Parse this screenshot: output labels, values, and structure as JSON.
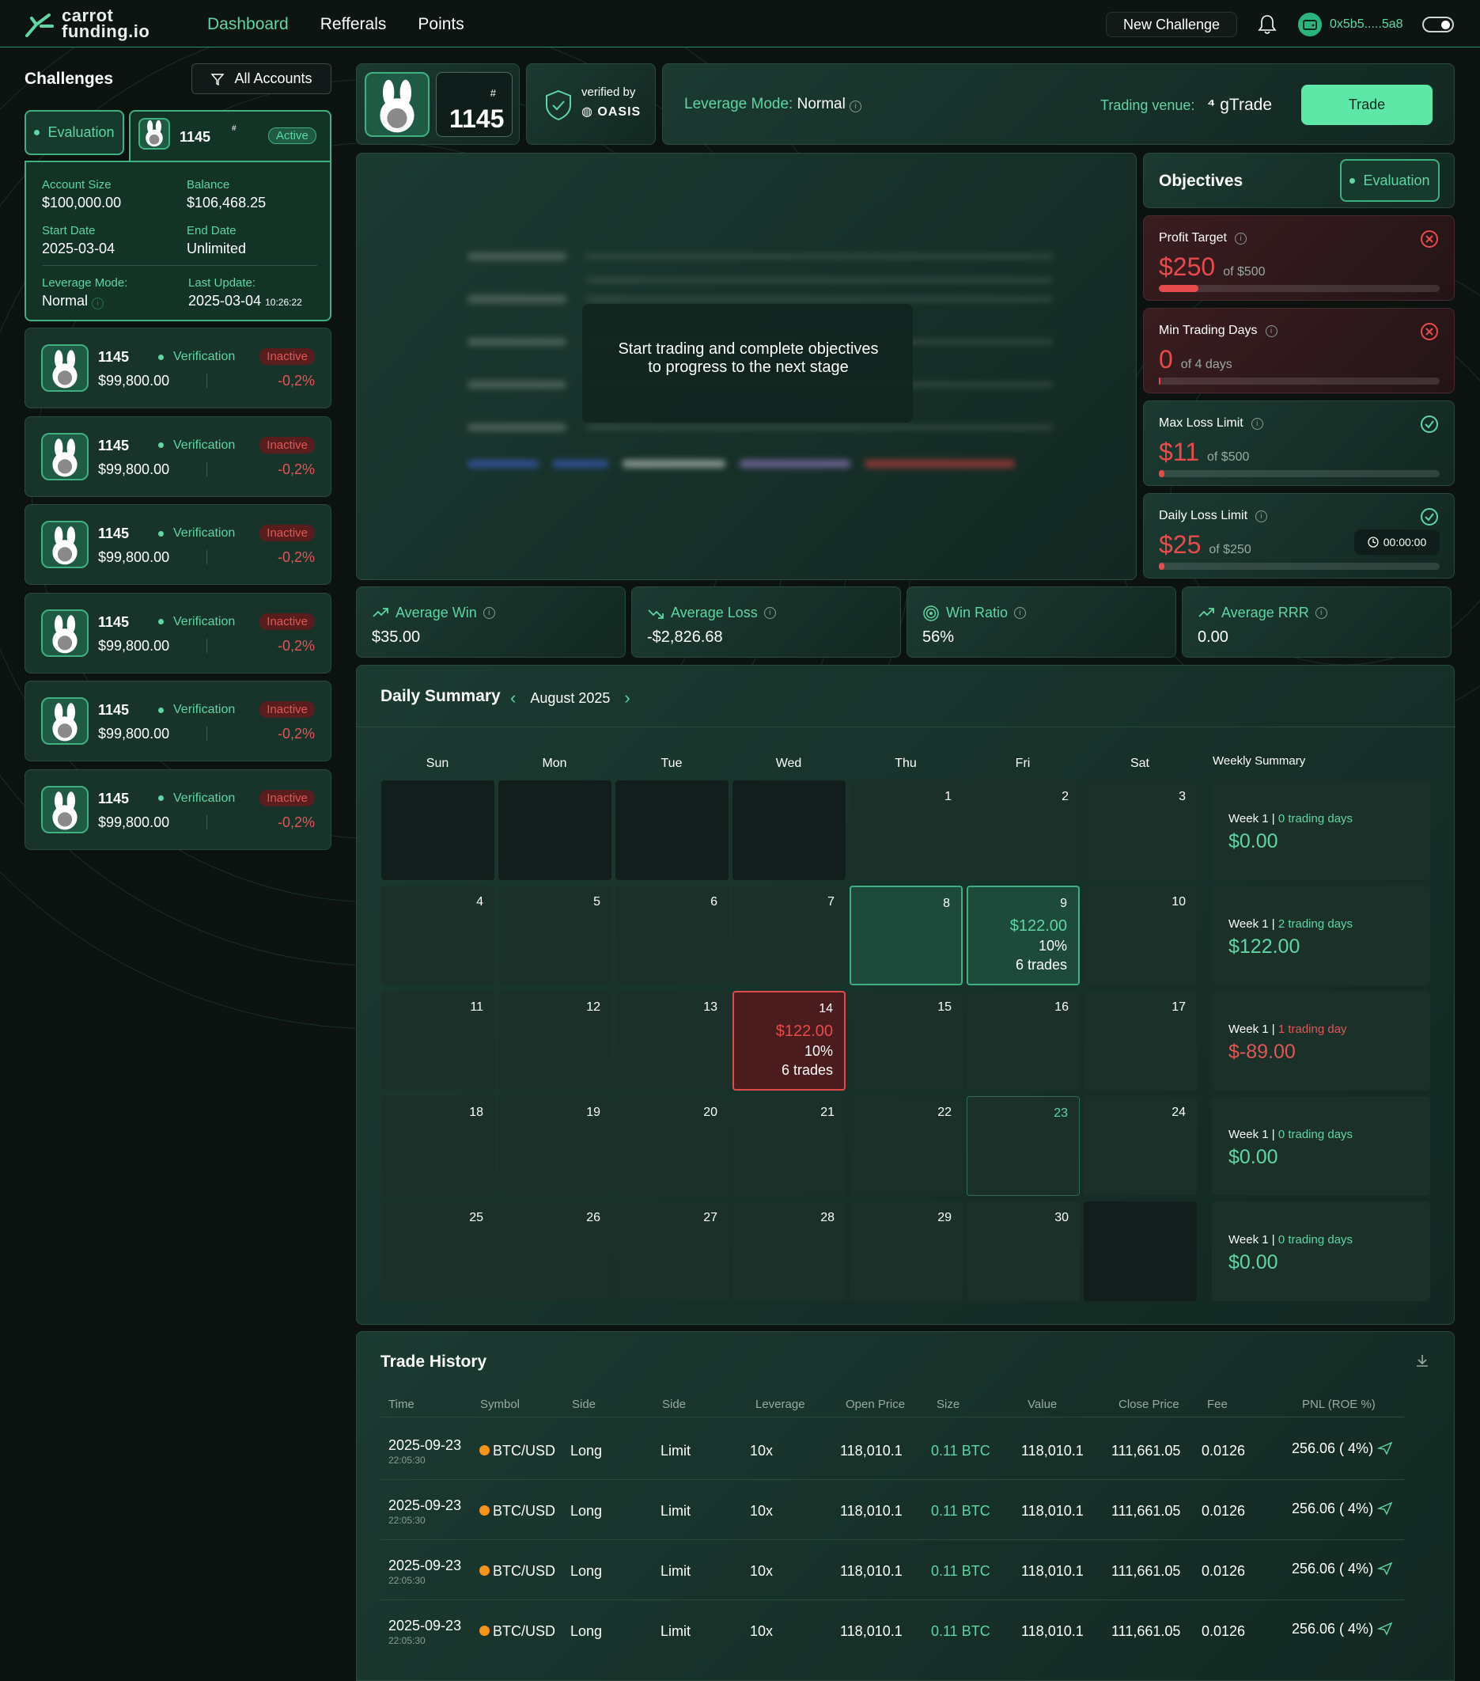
{
  "brand": {
    "line1": "carrot",
    "line2": "funding.io"
  },
  "nav": {
    "dashboard": "Dashboard",
    "referrals": "Refferals",
    "points": "Points"
  },
  "header": {
    "new_challenge": "New Challenge",
    "wallet": "0x5b5.....5a8"
  },
  "sidebar": {
    "title": "Challenges",
    "filter_label": "All Accounts",
    "eval_tab": "Evaluation",
    "active": {
      "hash": "#",
      "number": "1145",
      "badge": "Active",
      "account_size_label": "Account Size",
      "account_size": "$100,000.00",
      "balance_label": "Balance",
      "balance": "$106,468.25",
      "start_label": "Start Date",
      "start": "2025-03-04",
      "end_label": "End Date",
      "end": "Unlimited",
      "leverage_label": "Leverage Mode:",
      "leverage": "Normal",
      "update_label": "Last Update:",
      "update_date": "2025-03-04",
      "update_time": "10:26:22"
    },
    "accounts": [
      {
        "number": "1145",
        "status": "Verification",
        "badge": "Inactive",
        "amount": "$99,800.00",
        "pct": "-0,2%"
      },
      {
        "number": "1145",
        "status": "Verification",
        "badge": "Inactive",
        "amount": "$99,800.00",
        "pct": "-0,2%"
      },
      {
        "number": "1145",
        "status": "Verification",
        "badge": "Inactive",
        "amount": "$99,800.00",
        "pct": "-0,2%"
      },
      {
        "number": "1145",
        "status": "Verification",
        "badge": "Inactive",
        "amount": "$99,800.00",
        "pct": "-0,2%"
      },
      {
        "number": "1145",
        "status": "Verification",
        "badge": "Inactive",
        "amount": "$99,800.00",
        "pct": "-0,2%"
      },
      {
        "number": "1145",
        "status": "Verification",
        "badge": "Inactive",
        "amount": "$99,800.00",
        "pct": "-0,2%"
      }
    ]
  },
  "account_header": {
    "hash": "#",
    "number": "1145",
    "verified_by": "verified by",
    "verifier": "OASIS",
    "leverage_label": "Leverage Mode:",
    "leverage_value": "Normal",
    "venue_label": "Trading venue:",
    "venue_value": "gTrade",
    "trade_button": "Trade"
  },
  "chart": {
    "message": "Start trading and complete objectives to progress to the next stage"
  },
  "objectives": {
    "title": "Objectives",
    "badge": "Evaluation",
    "items": [
      {
        "name": "Profit Target",
        "value": "$250",
        "of": "of $500",
        "progress": 0.14,
        "state": "failed",
        "color": "#e84b4b"
      },
      {
        "name": "Min Trading Days",
        "value": "0",
        "of": "of 4 days",
        "progress": 0.0,
        "state": "failed",
        "color": "#e84b4b"
      },
      {
        "name": "Max Loss Limit",
        "value": "$11",
        "of": "of $500",
        "progress": 0.02,
        "state": "passed",
        "color": "#e84b4b"
      },
      {
        "name": "Daily Loss Limit",
        "value": "$25",
        "of": "of $250",
        "progress": 0.02,
        "state": "passed",
        "color": "#e84b4b",
        "timer": "00:00:00"
      }
    ]
  },
  "stats": [
    {
      "label": "Average Win",
      "value": "$35.00",
      "icon": "trend-up-icon"
    },
    {
      "label": "Average Loss",
      "value": "-$2,826.68",
      "icon": "trend-down-icon"
    },
    {
      "label": "Win Ratio",
      "value": "56%",
      "icon": "target-icon"
    },
    {
      "label": "Average RRR",
      "value": "0.00",
      "icon": "trend-up-icon"
    }
  ],
  "calendar": {
    "title": "Daily Summary",
    "month": "August 2025",
    "days": [
      "Sun",
      "Mon",
      "Tue",
      "Wed",
      "Thu",
      "Fri",
      "Sat"
    ],
    "weekly_title": "Weekly Summary",
    "weeks": [
      {
        "label": "Week 1 |",
        "days": "0 trading days",
        "amount": "$0.00",
        "negative": false
      },
      {
        "label": "Week 1 |",
        "days": "2 trading days",
        "amount": "$122.00",
        "negative": false
      },
      {
        "label": "Week 1 |",
        "days": "1 trading day",
        "amount": "$-89.00",
        "negative": true
      },
      {
        "label": "Week 1 |",
        "days": "0 trading days",
        "amount": "$0.00",
        "negative": false
      },
      {
        "label": "Week 1 |",
        "days": "0 trading days",
        "amount": "$0.00",
        "negative": false
      }
    ],
    "cells": {
      "fri9": {
        "day": "9",
        "pnl": "$122.00",
        "pct": "10%",
        "trades": "6 trades"
      },
      "wed14": {
        "day": "14",
        "pnl": "$122.00",
        "pct": "10%",
        "trades": "6 trades"
      }
    }
  },
  "trade_history": {
    "title": "Trade History",
    "columns": [
      "Time",
      "Symbol",
      "Side",
      "Side",
      "Leverage",
      "Open Price",
      "Size",
      "Value",
      "Close Price",
      "Fee",
      "PNL (ROE %)"
    ],
    "rows": [
      {
        "date": "2025-09-23",
        "time": "22:05:30",
        "symbol": "BTC/USD",
        "side": "Long",
        "type": "Limit",
        "leverage": "10x",
        "open": "118,010.1",
        "size": "0.11 BTC",
        "value": "118,010.1",
        "close": "111,661.05",
        "fee": "0.0126",
        "pnl": "256.06 ( 4%)"
      },
      {
        "date": "2025-09-23",
        "time": "22:05:30",
        "symbol": "BTC/USD",
        "side": "Long",
        "type": "Limit",
        "leverage": "10x",
        "open": "118,010.1",
        "size": "0.11 BTC",
        "value": "118,010.1",
        "close": "111,661.05",
        "fee": "0.0126",
        "pnl": "256.06 ( 4%)"
      },
      {
        "date": "2025-09-23",
        "time": "22:05:30",
        "symbol": "BTC/USD",
        "side": "Long",
        "type": "Limit",
        "leverage": "10x",
        "open": "118,010.1",
        "size": "0.11 BTC",
        "value": "118,010.1",
        "close": "111,661.05",
        "fee": "0.0126",
        "pnl": "256.06 ( 4%)"
      },
      {
        "date": "2025-09-23",
        "time": "22:05:30",
        "symbol": "BTC/USD",
        "side": "Long",
        "type": "Limit",
        "leverage": "10x",
        "open": "118,010.1",
        "size": "0.11 BTC",
        "value": "118,010.1",
        "close": "111,661.05",
        "fee": "0.0126",
        "pnl": "256.06 ( 4%)"
      }
    ]
  }
}
